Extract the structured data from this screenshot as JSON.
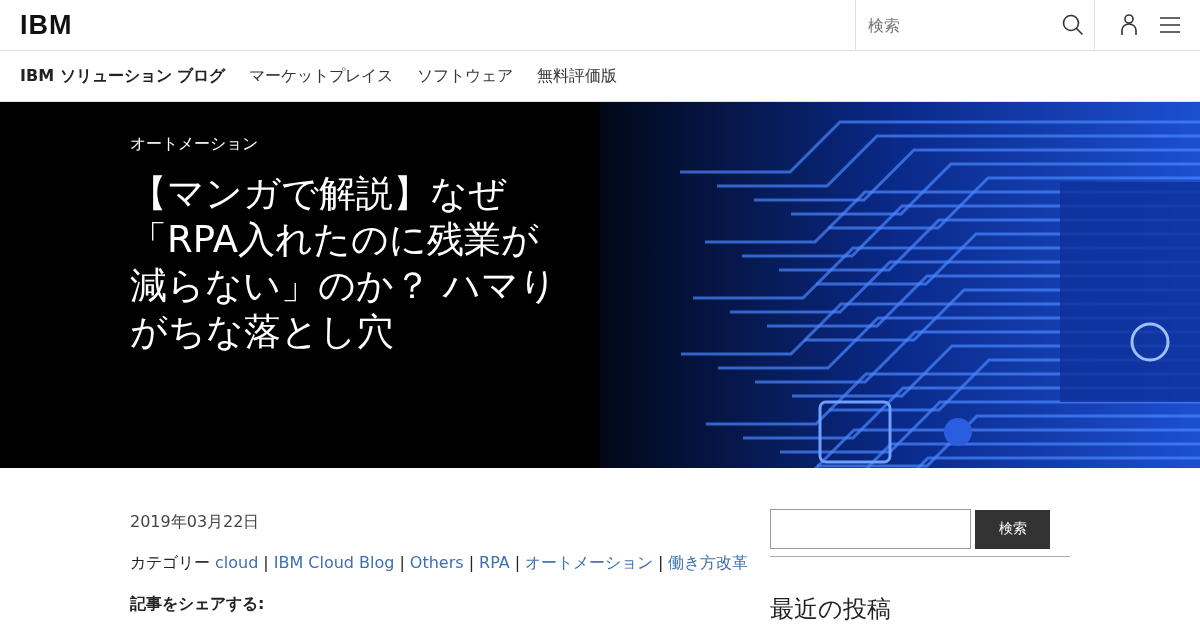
{
  "header": {
    "logo": "IBM",
    "search_placeholder": "検索"
  },
  "subnav": {
    "title": "IBM ソリューション ブログ",
    "items": [
      "マーケットプレイス",
      "ソフトウェア",
      "無料評価版"
    ]
  },
  "hero": {
    "kind": "picture",
    "category": "オートメーション",
    "title": "【マンガで解説】なぜ「RPA入れたのに残業が減らない」のか？ ハマりがちな落とし穴"
  },
  "article": {
    "date": "2019年03月22日",
    "category_label": "カテゴリー",
    "separator": "|",
    "categories": [
      "cloud",
      "IBM Cloud Blog",
      "Others",
      "RPA",
      "オートメーション",
      "働き方改革"
    ],
    "share_label": "記事をシェアする:"
  },
  "sidebar": {
    "search_button": "検索",
    "recent_heading": "最近の投稿"
  }
}
